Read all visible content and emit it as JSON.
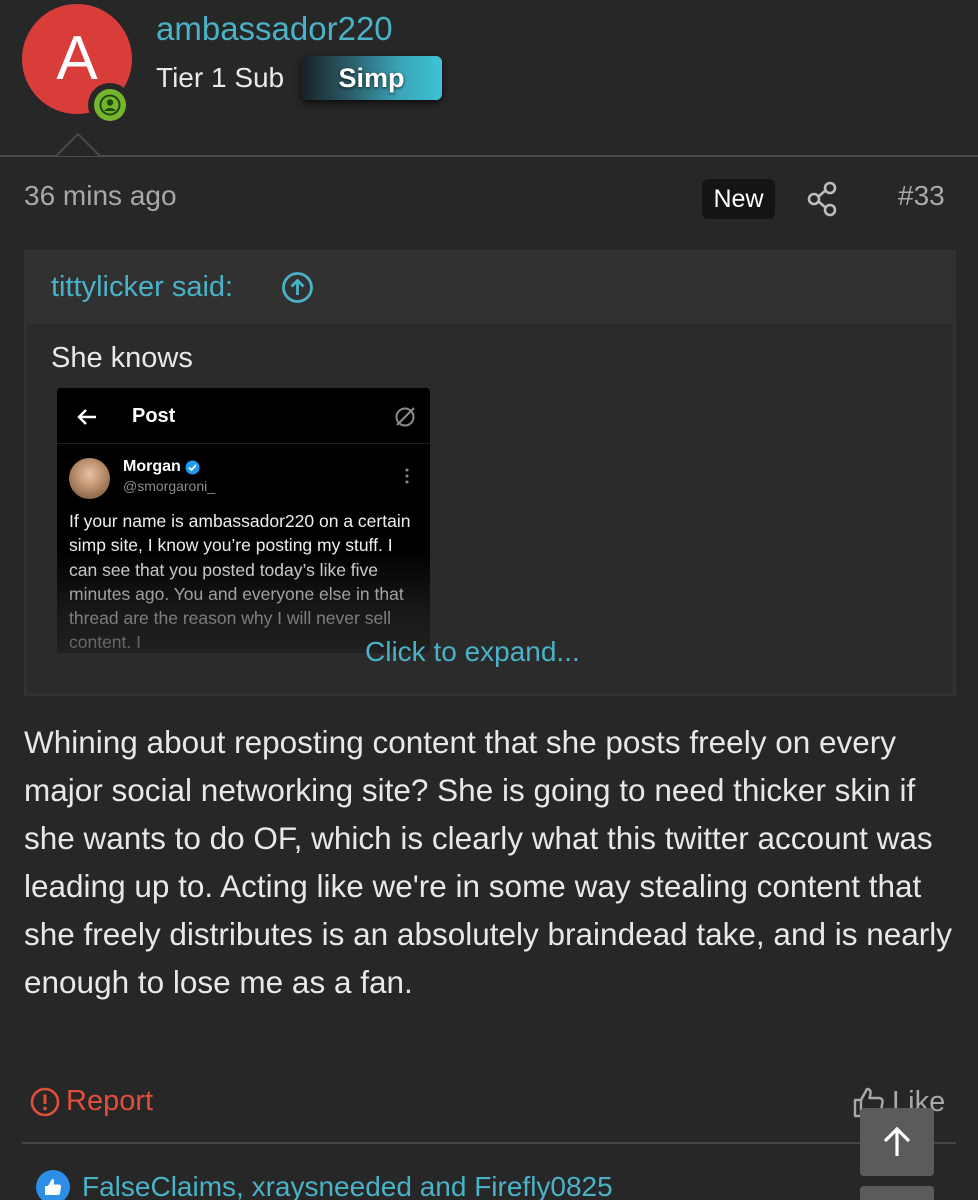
{
  "user": {
    "avatar_letter": "A",
    "username": "ambassador220",
    "title": "Tier 1 Sub",
    "badge": "Simp"
  },
  "post": {
    "timestamp": "36 mins ago",
    "new_label": "New",
    "number": "#33",
    "body": "Whining about reposting content that she posts freely on every major social networking site? She is going to need thicker skin if she wants to do OF, which is clearly what this twitter account was leading up to. Acting like we're in some way stealing content that she freely distributes is an absolutely braindead take, and is nearly enough to lose me as a fan."
  },
  "quote": {
    "author_line": "tittylicker said:",
    "text": "She knows",
    "expand_label": "Click to expand...",
    "embedded_tweet": {
      "bar_title": "Post",
      "name": "Morgan",
      "handle": "@smorgaroni_",
      "text": "If your name is ambassador220 on a certain simp site, I know you’re posting my stuff. I can see that you posted today’s like five minutes ago. You and everyone else in that thread are the reason why I will never sell content. I"
    }
  },
  "actions": {
    "report_label": "Report",
    "like_label": "Like"
  },
  "reactions": {
    "text": "FalseClaims, xraysneeded and Firefly0825"
  },
  "colors": {
    "background": "#272727",
    "link": "#4ab2c7",
    "report": "#e04f3b",
    "avatar": "#d93d3a",
    "online": "#75b52b",
    "reaction_icon": "#2d8ee8"
  },
  "icons": {
    "online": "user-online-icon",
    "share": "share-icon",
    "quote_jump": "arrow-up-circle-icon",
    "report": "exclamation-circle-icon",
    "like": "thumbs-up-icon",
    "scroll_top": "arrow-up-icon"
  }
}
